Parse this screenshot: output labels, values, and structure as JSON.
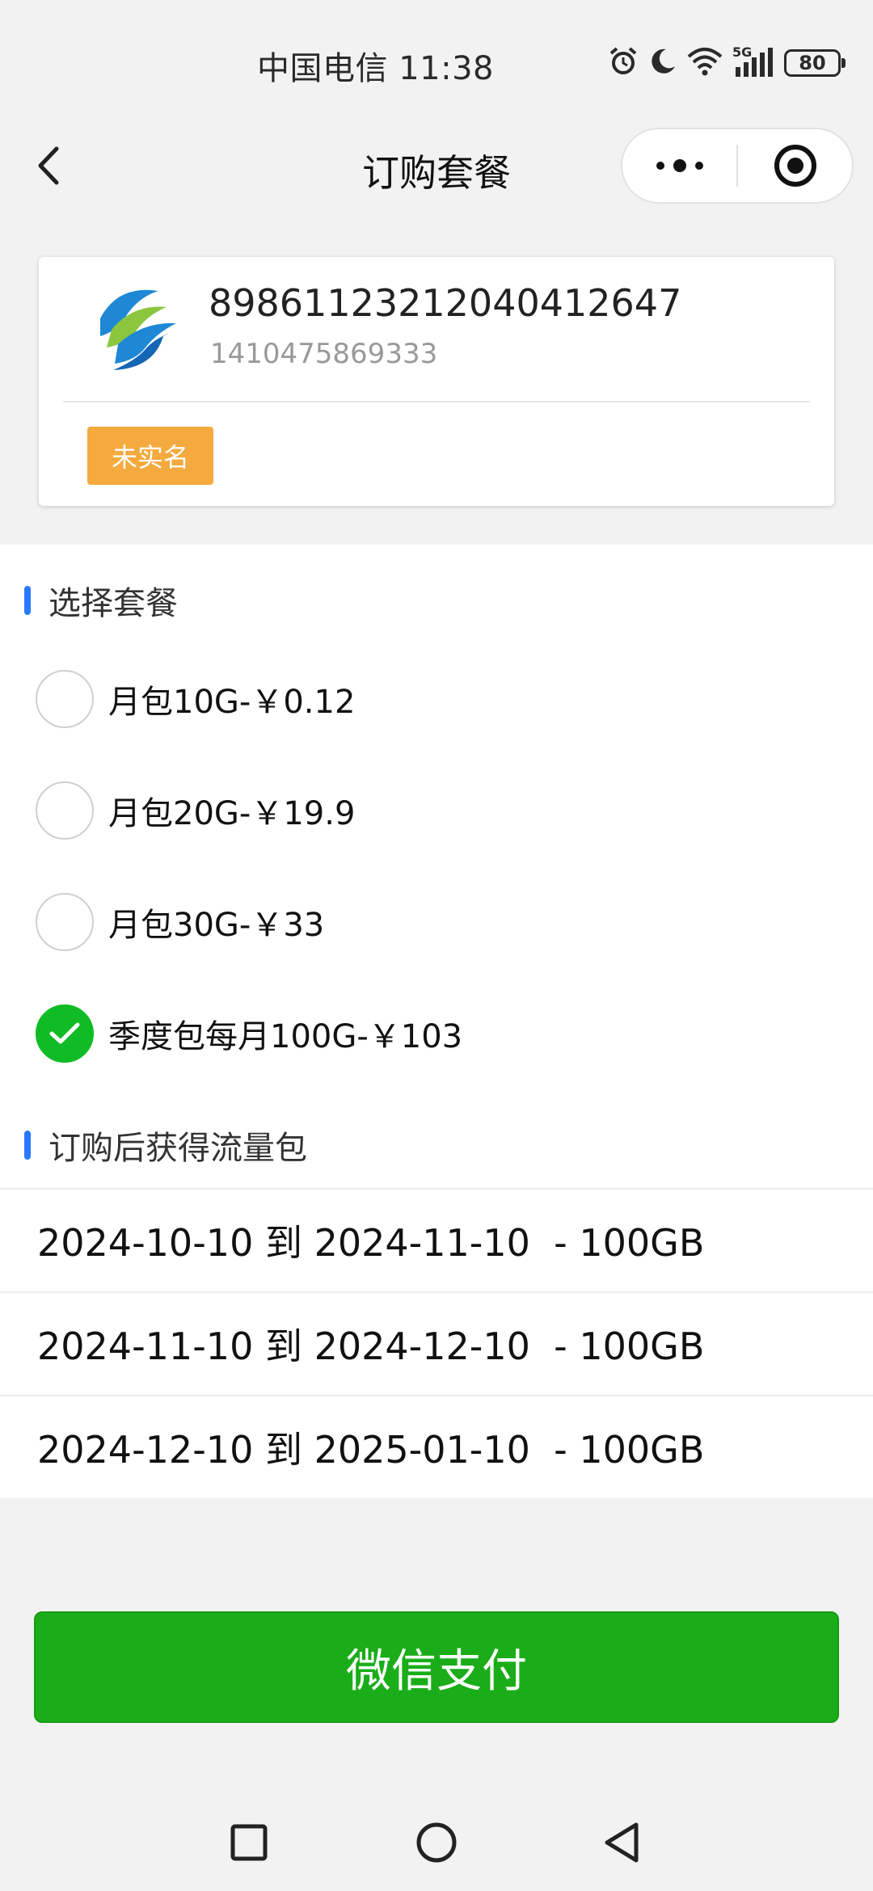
{
  "status_bar": {
    "carrier_time": "中国电信 11:38",
    "network_label": "5G",
    "battery": "80",
    "icons": [
      "alarm-icon",
      "moon-icon",
      "wifi-icon",
      "signal-icon",
      "battery-icon"
    ]
  },
  "nav": {
    "title": "订购套餐",
    "back_icon": "chevron-left-icon",
    "more_icon": "more-dots-icon",
    "close_icon": "target-close-icon"
  },
  "sim_card": {
    "logo": "china-mobile-logo",
    "iccid": "89861123212040412647",
    "msisdn": "1410475869333",
    "status_badge": "未实名",
    "badge_color": "#f4aa3e"
  },
  "plans": {
    "heading": "选择套餐",
    "items": [
      {
        "label": "月包10G-￥0.12",
        "selected": false
      },
      {
        "label": "月包20G-￥19.9",
        "selected": false
      },
      {
        "label": "月包30G-￥33",
        "selected": false
      },
      {
        "label": "季度包每月100G-￥103",
        "selected": true
      }
    ]
  },
  "packages": {
    "heading": "订购后获得流量包",
    "rows": [
      "2024-10-10 到 2024-11-10  - 100GB",
      "2024-11-10 到 2024-12-10  - 100GB",
      "2024-12-10 到 2025-01-10  - 100GB"
    ]
  },
  "pay_button": {
    "label": "微信支付",
    "color": "#1aad19"
  },
  "system_nav": {
    "icons": [
      "recent-apps-icon",
      "home-icon",
      "back-triangle-icon"
    ]
  },
  "colors": {
    "accent_blue": "#2979ff",
    "check_green": "#0fbc25"
  }
}
